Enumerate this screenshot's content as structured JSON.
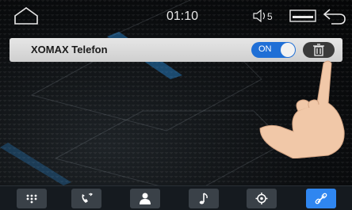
{
  "status": {
    "time": "01:10",
    "volume_level": "5"
  },
  "bluetooth_device": {
    "name": "XOMAX Telefon",
    "toggle_label": "ON",
    "toggle_on": true
  },
  "nav": {
    "items": [
      {
        "name": "dialpad-icon",
        "active": false
      },
      {
        "name": "call-log-icon",
        "active": false
      },
      {
        "name": "contacts-icon",
        "active": false
      },
      {
        "name": "music-icon",
        "active": false
      },
      {
        "name": "settings-icon",
        "active": false
      },
      {
        "name": "link-icon",
        "active": true
      }
    ]
  },
  "colors": {
    "accent": "#2f86f0",
    "toggle_on": "#1f6fd6",
    "row_bg": "#d9d9d9",
    "nav_bg": "#151a1f"
  }
}
